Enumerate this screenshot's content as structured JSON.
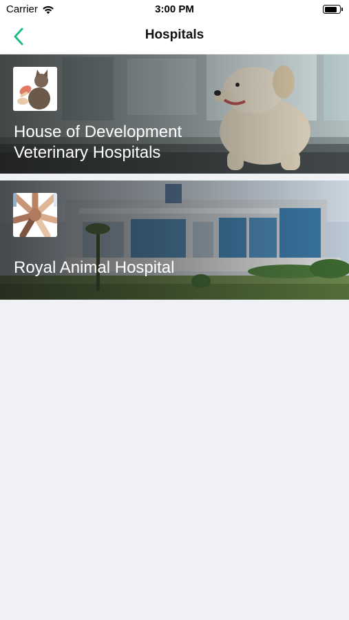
{
  "status_bar": {
    "carrier": "Carrier",
    "time": "3:00 PM"
  },
  "nav": {
    "title": "Hospitals",
    "back_icon": "chevron-left-icon",
    "accent_color": "#1fb98a"
  },
  "hospitals": [
    {
      "name_line1": "House of Development",
      "name_line2": "Veterinary Hospitals",
      "thumb_icon": "cat-icon",
      "background": "dog-photo"
    },
    {
      "name_line1": "Royal Animal Hospital",
      "thumb_icon": "hands-icon",
      "background": "building-photo"
    }
  ],
  "colors": {
    "page_background": "#eff1f5",
    "card_text": "#ffffff"
  }
}
